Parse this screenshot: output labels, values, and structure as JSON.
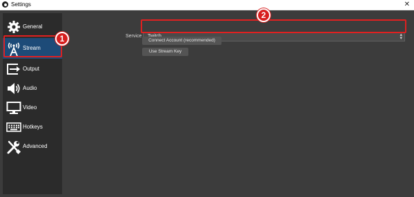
{
  "window": {
    "title": "Settings",
    "close_glyph": "✕"
  },
  "sidebar": {
    "items": [
      {
        "label": "General",
        "icon": "gear-icon"
      },
      {
        "label": "Stream",
        "icon": "broadcast-antenna-icon",
        "active": true
      },
      {
        "label": "Output",
        "icon": "output-arrow-icon"
      },
      {
        "label": "Audio",
        "icon": "speaker-icon"
      },
      {
        "label": "Video",
        "icon": "monitor-icon"
      },
      {
        "label": "Hotkeys",
        "icon": "keyboard-icon"
      },
      {
        "label": "Advanced",
        "icon": "tools-icon"
      }
    ]
  },
  "stream": {
    "service_label": "Service",
    "service_value": "Twitch",
    "connect_button": "Connect Account (recommended)",
    "stream_key_button": "Use Stream Key"
  },
  "annotations": {
    "step1": "1",
    "step2": "2"
  },
  "colors": {
    "accent_active": "#1d4b78",
    "annotation_red": "#e02020",
    "panel_bg": "#3c3c3c",
    "sidebar_bg": "#2b2b2b"
  }
}
